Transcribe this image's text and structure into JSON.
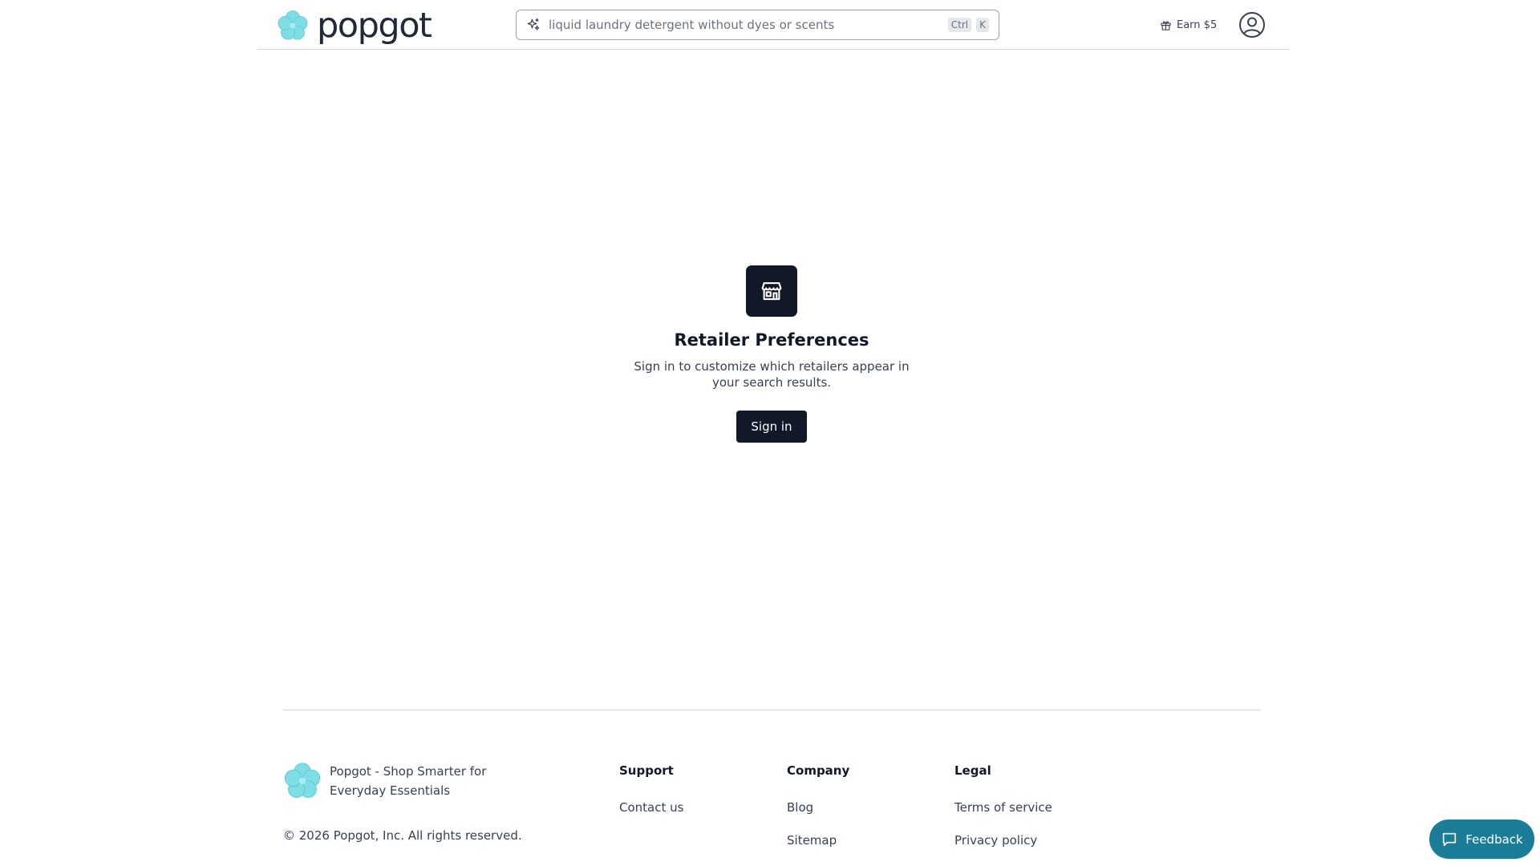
{
  "header": {
    "brand_name": "popgot",
    "search": {
      "placeholder": "liquid laundry detergent without dyes or scents",
      "shortcut_keys": [
        "Ctrl",
        "K"
      ]
    },
    "earn_label": "Earn $5"
  },
  "main": {
    "title": "Retailer Preferences",
    "description": "Sign in to customize which retailers appear in your search results.",
    "signin_label": "Sign in"
  },
  "footer": {
    "tagline": "Popgot - Shop Smarter for Everyday Essentials",
    "copyright": "© 2026 Popgot, Inc. All rights reserved.",
    "columns": [
      {
        "heading": "Support",
        "links": [
          "Contact us"
        ]
      },
      {
        "heading": "Company",
        "links": [
          "Blog",
          "Sitemap"
        ]
      },
      {
        "heading": "Legal",
        "links": [
          "Terms of service",
          "Privacy policy"
        ]
      }
    ]
  },
  "feedback_label": "Feedback",
  "colors": {
    "brand_flower": "#7fdde6",
    "primary_dark": "#111827",
    "feedback_bg": "#1a7c96"
  },
  "icons": {
    "search": "sparkle-icon",
    "earn": "gift-icon",
    "account": "user-circle-icon",
    "main": "storefront-icon",
    "feedback": "chat-bubble-icon"
  }
}
